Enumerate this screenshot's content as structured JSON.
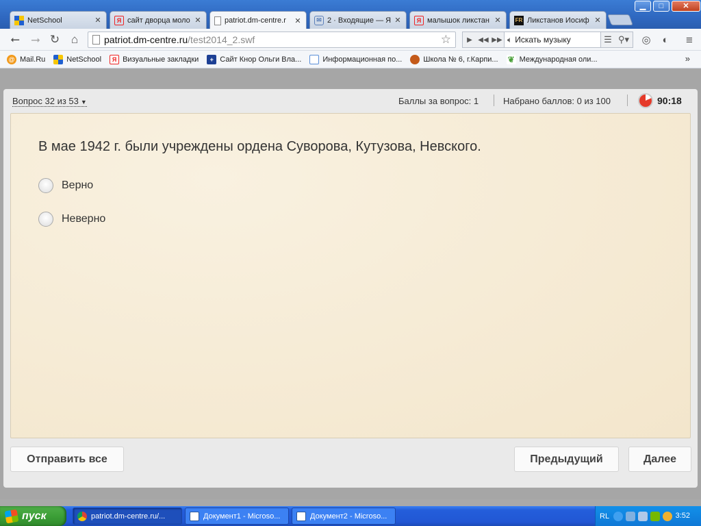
{
  "browser": {
    "window_buttons": {
      "minimize": "▁",
      "maximize": "□",
      "close": "✕"
    },
    "tabs": [
      {
        "label": "NetSchool",
        "icon": "netschool-icon",
        "active": false
      },
      {
        "label": "сайт дворца моло",
        "icon": "yandex-icon",
        "active": false
      },
      {
        "label": "patriot.dm-centre.r",
        "icon": "page-icon",
        "active": true
      },
      {
        "label": "2 · Входящие — Я",
        "icon": "mail-icon",
        "active": false
      },
      {
        "label": "малышок ликстан",
        "icon": "yandex-icon",
        "active": false
      },
      {
        "label": "Ликстанов Иосиф",
        "icon": "fr-icon",
        "active": false
      }
    ],
    "address": {
      "host": "patriot.dm-centre.ru",
      "path": "/test2014_2.swf"
    },
    "music_search_placeholder": "Искать музыку",
    "bookmarks": [
      {
        "label": "Mail.Ru",
        "icon": "mailru-icon",
        "color": "#f29a1c"
      },
      {
        "label": "NetSchool",
        "icon": "netschool-icon",
        "color": "#1f5fcf"
      },
      {
        "label": "Визуальные закладки",
        "icon": "yandex-icon",
        "color": "#e22"
      },
      {
        "label": "Сайт Кнор Ольги Вла...",
        "icon": "uk-flag-icon",
        "color": "#1c3f94"
      },
      {
        "label": "Информационная по...",
        "icon": "doc-icon",
        "color": "#5a8fd8"
      },
      {
        "label": "Школа № 6, г.Карпи...",
        "icon": "school-icon",
        "color": "#c45a1a"
      },
      {
        "label": "Международная оли...",
        "icon": "leaf-icon",
        "color": "#4aa03a"
      }
    ],
    "bookmarks_more": "»"
  },
  "test": {
    "question_counter": "Вопрос 32 из 53",
    "points_per_question": "Баллы за вопрос: 1",
    "total_points": "Набрано баллов: 0 из 100",
    "timer": "90:18",
    "question_text": "В мае 1942 г. были учреждены ордена Суворова, Кутузова, Невского.",
    "options": [
      "Верно",
      "Неверно"
    ],
    "buttons": {
      "submit_all": "Отправить все",
      "previous": "Предыдущий",
      "next": "Далее"
    }
  },
  "taskbar": {
    "start_label": "пуск",
    "tasks": [
      {
        "label": "patriot.dm-centre.ru/...",
        "icon": "chrome-icon",
        "active": false
      },
      {
        "label": "Документ1 - Microso...",
        "icon": "word-icon",
        "active": false
      },
      {
        "label": "Документ2 - Microso...",
        "icon": "word-icon",
        "active": false
      }
    ],
    "language": "RL",
    "clock": "3:52"
  }
}
